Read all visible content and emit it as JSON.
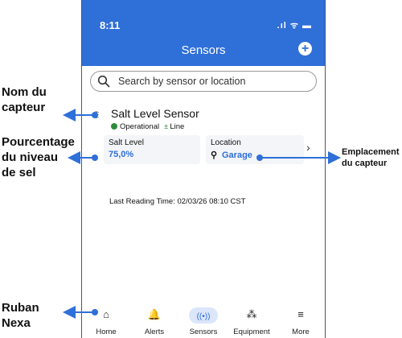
{
  "status_bar": {
    "time": "8:11",
    "icons": ".ıl ᯤ ▬"
  },
  "header": {
    "title": "Sensors",
    "add_icon": "plus-circle-icon"
  },
  "search": {
    "placeholder": "Search by sensor or location"
  },
  "sensor_card": {
    "name": "Salt Level Sensor",
    "status": "Operational",
    "power": "Line",
    "salt_label": "Salt Level",
    "salt_value": "75,0%",
    "location_label": "Location",
    "location_value": "Garage",
    "last_reading": "Last Reading Time:  02/03/26 08:10 CST"
  },
  "tabs": [
    {
      "label": "Home",
      "icon": "⌂"
    },
    {
      "label": "Alerts",
      "icon": "🔔"
    },
    {
      "label": "Sensors",
      "icon": "((•))"
    },
    {
      "label": "Equipment",
      "icon": "⁂"
    },
    {
      "label": "More",
      "icon": "≡"
    }
  ],
  "callouts": {
    "sensor_name": "Nom du capteur",
    "salt_percent": "Pourcentage du niveau de sel",
    "location": "Emplacement du capteur",
    "nav_ribbon": "Ruban Nexa"
  },
  "colors": {
    "brand_blue": "#2f6fd8",
    "status_green": "#2e8b3a",
    "active_tab_bg": "#dbe6fb"
  }
}
